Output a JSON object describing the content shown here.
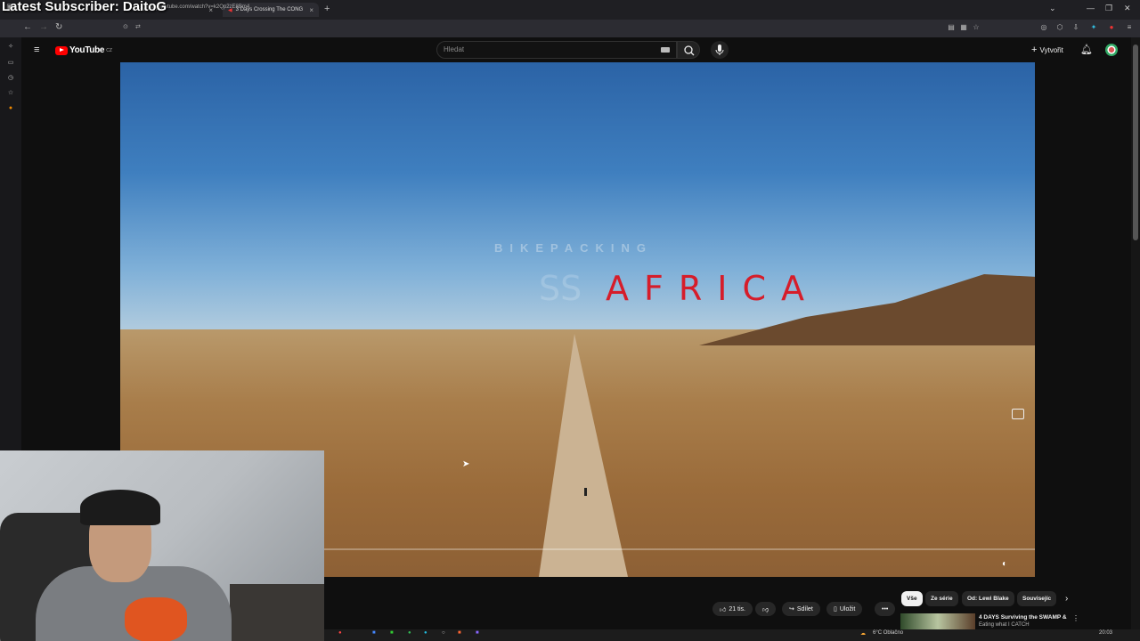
{
  "overlay": {
    "title": "Latest Subscriber: DaitoG"
  },
  "browser": {
    "tabs": [
      {
        "label": "L",
        "active": false
      },
      {
        "label": "SWAMP &",
        "active": false
      },
      {
        "label": "3 Days Crossing The CONG",
        "active": true
      }
    ],
    "url": "www.youtube.com/watch?v=k2Qp2zE8Bm4",
    "window_controls": [
      "minimize",
      "restore",
      "close"
    ]
  },
  "youtube": {
    "logo": "YouTube",
    "region": "CZ",
    "search_placeholder": "Hledat",
    "create_label": "Vytvořit"
  },
  "video": {
    "subtitle": "BIKEPACKING",
    "title": "AFRICA",
    "ghost_letters": "SS"
  },
  "actions": {
    "likes": "21 tis.",
    "share": "Sdílet",
    "save": "Uložit"
  },
  "chips": [
    "Vše",
    "Ze série",
    "Od: Lewi Blake",
    "Souvisejíc"
  ],
  "chips_selected": 0,
  "related": {
    "title": "4 DAYS Surviving the SWAMP &",
    "subtitle": "Eating what I CATCH"
  },
  "taskbar": {
    "weather": "6°C  Oblačno",
    "time": "20:03"
  },
  "colors": {
    "accent_red": "#d61d2a",
    "yt_red": "#ff0000",
    "bg": "#0f0f0f"
  }
}
